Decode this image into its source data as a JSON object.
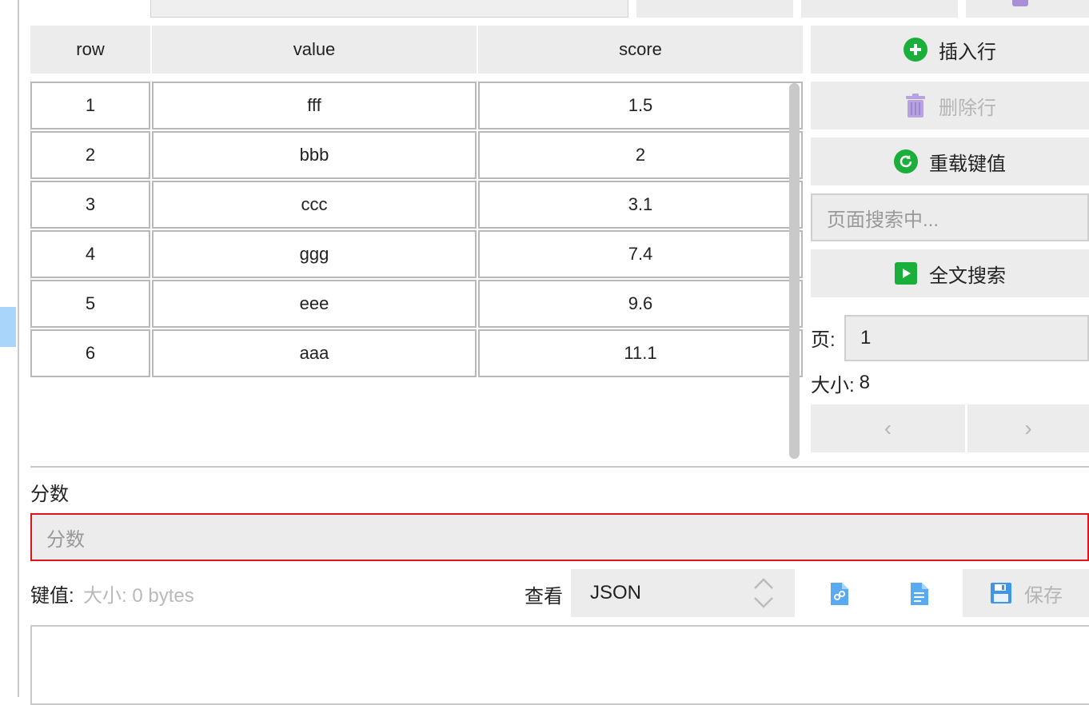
{
  "table": {
    "headers": [
      "row",
      "value",
      "score"
    ],
    "rows": [
      {
        "row": "1",
        "value": "fff",
        "score": "1.5"
      },
      {
        "row": "2",
        "value": "bbb",
        "score": "2"
      },
      {
        "row": "3",
        "value": "ccc",
        "score": "3.1"
      },
      {
        "row": "4",
        "value": "ggg",
        "score": "7.4"
      },
      {
        "row": "5",
        "value": "eee",
        "score": "9.6"
      },
      {
        "row": "6",
        "value": "aaa",
        "score": "11.1"
      }
    ]
  },
  "side": {
    "insert_row": "插入行",
    "delete_row": "删除行",
    "reload_value": "重载键值",
    "search_placeholder": "页面搜索中...",
    "full_search": "全文搜索",
    "page_label": "页:",
    "page_value": "1",
    "size_label": "大小:",
    "size_value": "8",
    "prev": "‹",
    "next": "›"
  },
  "score_section": {
    "label": "分数",
    "placeholder": "分数"
  },
  "value_section": {
    "label": "键值:",
    "size_info": "大小: 0 bytes",
    "view_label": "查看",
    "view_format": "JSON",
    "save_label": "保存"
  },
  "colors": {
    "accent_green": "#1aae3a",
    "trash_purple": "#a98fd6",
    "file_blue": "#4aa3f0",
    "error_red": "#e0141c"
  }
}
